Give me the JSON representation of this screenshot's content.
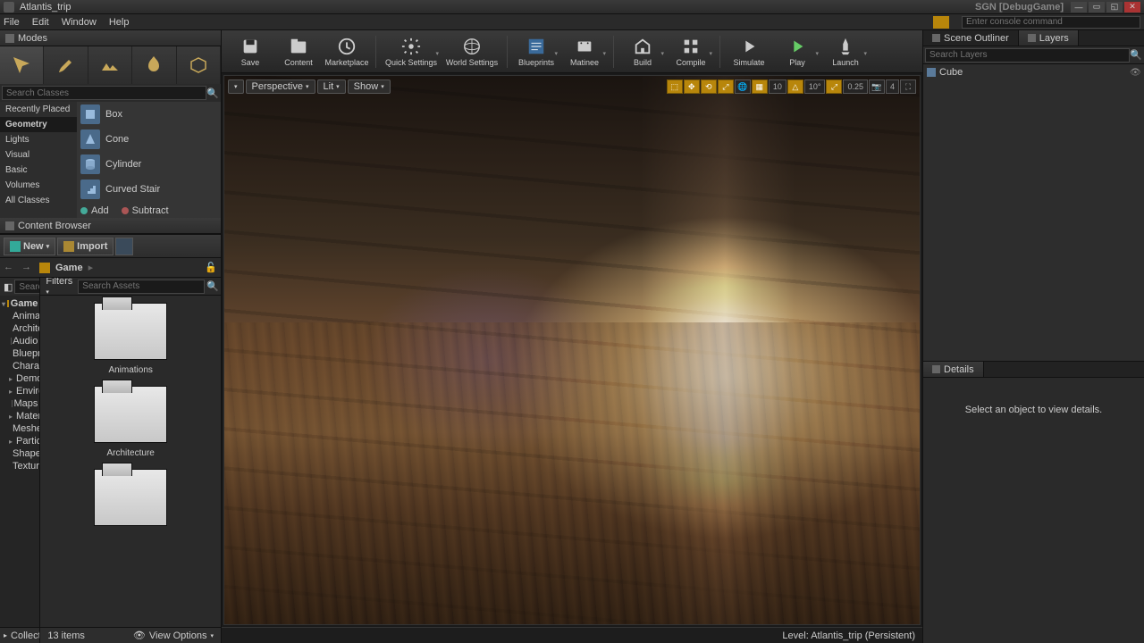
{
  "titlebar": {
    "title": "Atlantis_trip",
    "right_title": "SGN [DebugGame]"
  },
  "menubar": {
    "items": [
      "File",
      "Edit",
      "Window",
      "Help"
    ],
    "console_placeholder": "Enter console command"
  },
  "modes": {
    "tab_label": "Modes",
    "search_placeholder": "Search Classes",
    "categories": [
      "Recently Placed",
      "Geometry",
      "Lights",
      "Visual",
      "Basic",
      "Volumes",
      "All Classes"
    ],
    "active_category": "Geometry",
    "shapes": [
      "Box",
      "Cone",
      "Cylinder",
      "Curved Stair"
    ],
    "add_label": "Add",
    "subtract_label": "Subtract"
  },
  "content_browser": {
    "tab_label": "Content Browser",
    "new_label": "New",
    "import_label": "Import",
    "crumb": "Game",
    "search_folders_placeholder": "Search Folders",
    "filters_label": "Filters",
    "search_assets_placeholder": "Search Assets",
    "tree_root": "Game",
    "tree": [
      "Animations",
      "Architecture",
      "Audio",
      "Blueprints",
      "Character",
      "Demos",
      "Environments",
      "Maps",
      "Materials",
      "Meshes",
      "Particles",
      "Shapes",
      "Textures"
    ],
    "collections_label": "Collections",
    "assets": [
      "Animations",
      "Architecture"
    ],
    "item_count": "13 items",
    "view_options": "View Options"
  },
  "toolbar": {
    "items": [
      {
        "label": "Save",
        "icon": "save"
      },
      {
        "label": "Content",
        "icon": "content"
      },
      {
        "label": "Marketplace",
        "icon": "market"
      },
      {
        "label": "Quick Settings",
        "icon": "settings",
        "dd": true,
        "wide": true
      },
      {
        "label": "World Settings",
        "icon": "world",
        "wide": true
      },
      {
        "label": "Blueprints",
        "icon": "blueprint",
        "dd": true
      },
      {
        "label": "Matinee",
        "icon": "matinee",
        "dd": true
      },
      {
        "label": "Build",
        "icon": "build",
        "dd": true
      },
      {
        "label": "Compile",
        "icon": "compile",
        "dd": true
      },
      {
        "label": "Simulate",
        "icon": "simulate"
      },
      {
        "label": "Play",
        "icon": "play",
        "dd": true
      },
      {
        "label": "Launch",
        "icon": "launch",
        "dd": true
      }
    ],
    "separators_after": [
      2,
      4,
      6,
      8
    ]
  },
  "viewport": {
    "perspective": "Perspective",
    "lit": "Lit",
    "show": "Show",
    "snap_grid": "10",
    "snap_angle": "10°",
    "snap_scale": "0.25",
    "cam_speed": "4",
    "status": "Level: Atlantis_trip (Persistent)"
  },
  "right": {
    "tabs": [
      "Scene Outliner",
      "Layers"
    ],
    "active_tab": 1,
    "search_placeholder": "Search Layers",
    "layers": [
      "Cube"
    ],
    "details_tab": "Details",
    "details_empty": "Select an object to view details."
  }
}
